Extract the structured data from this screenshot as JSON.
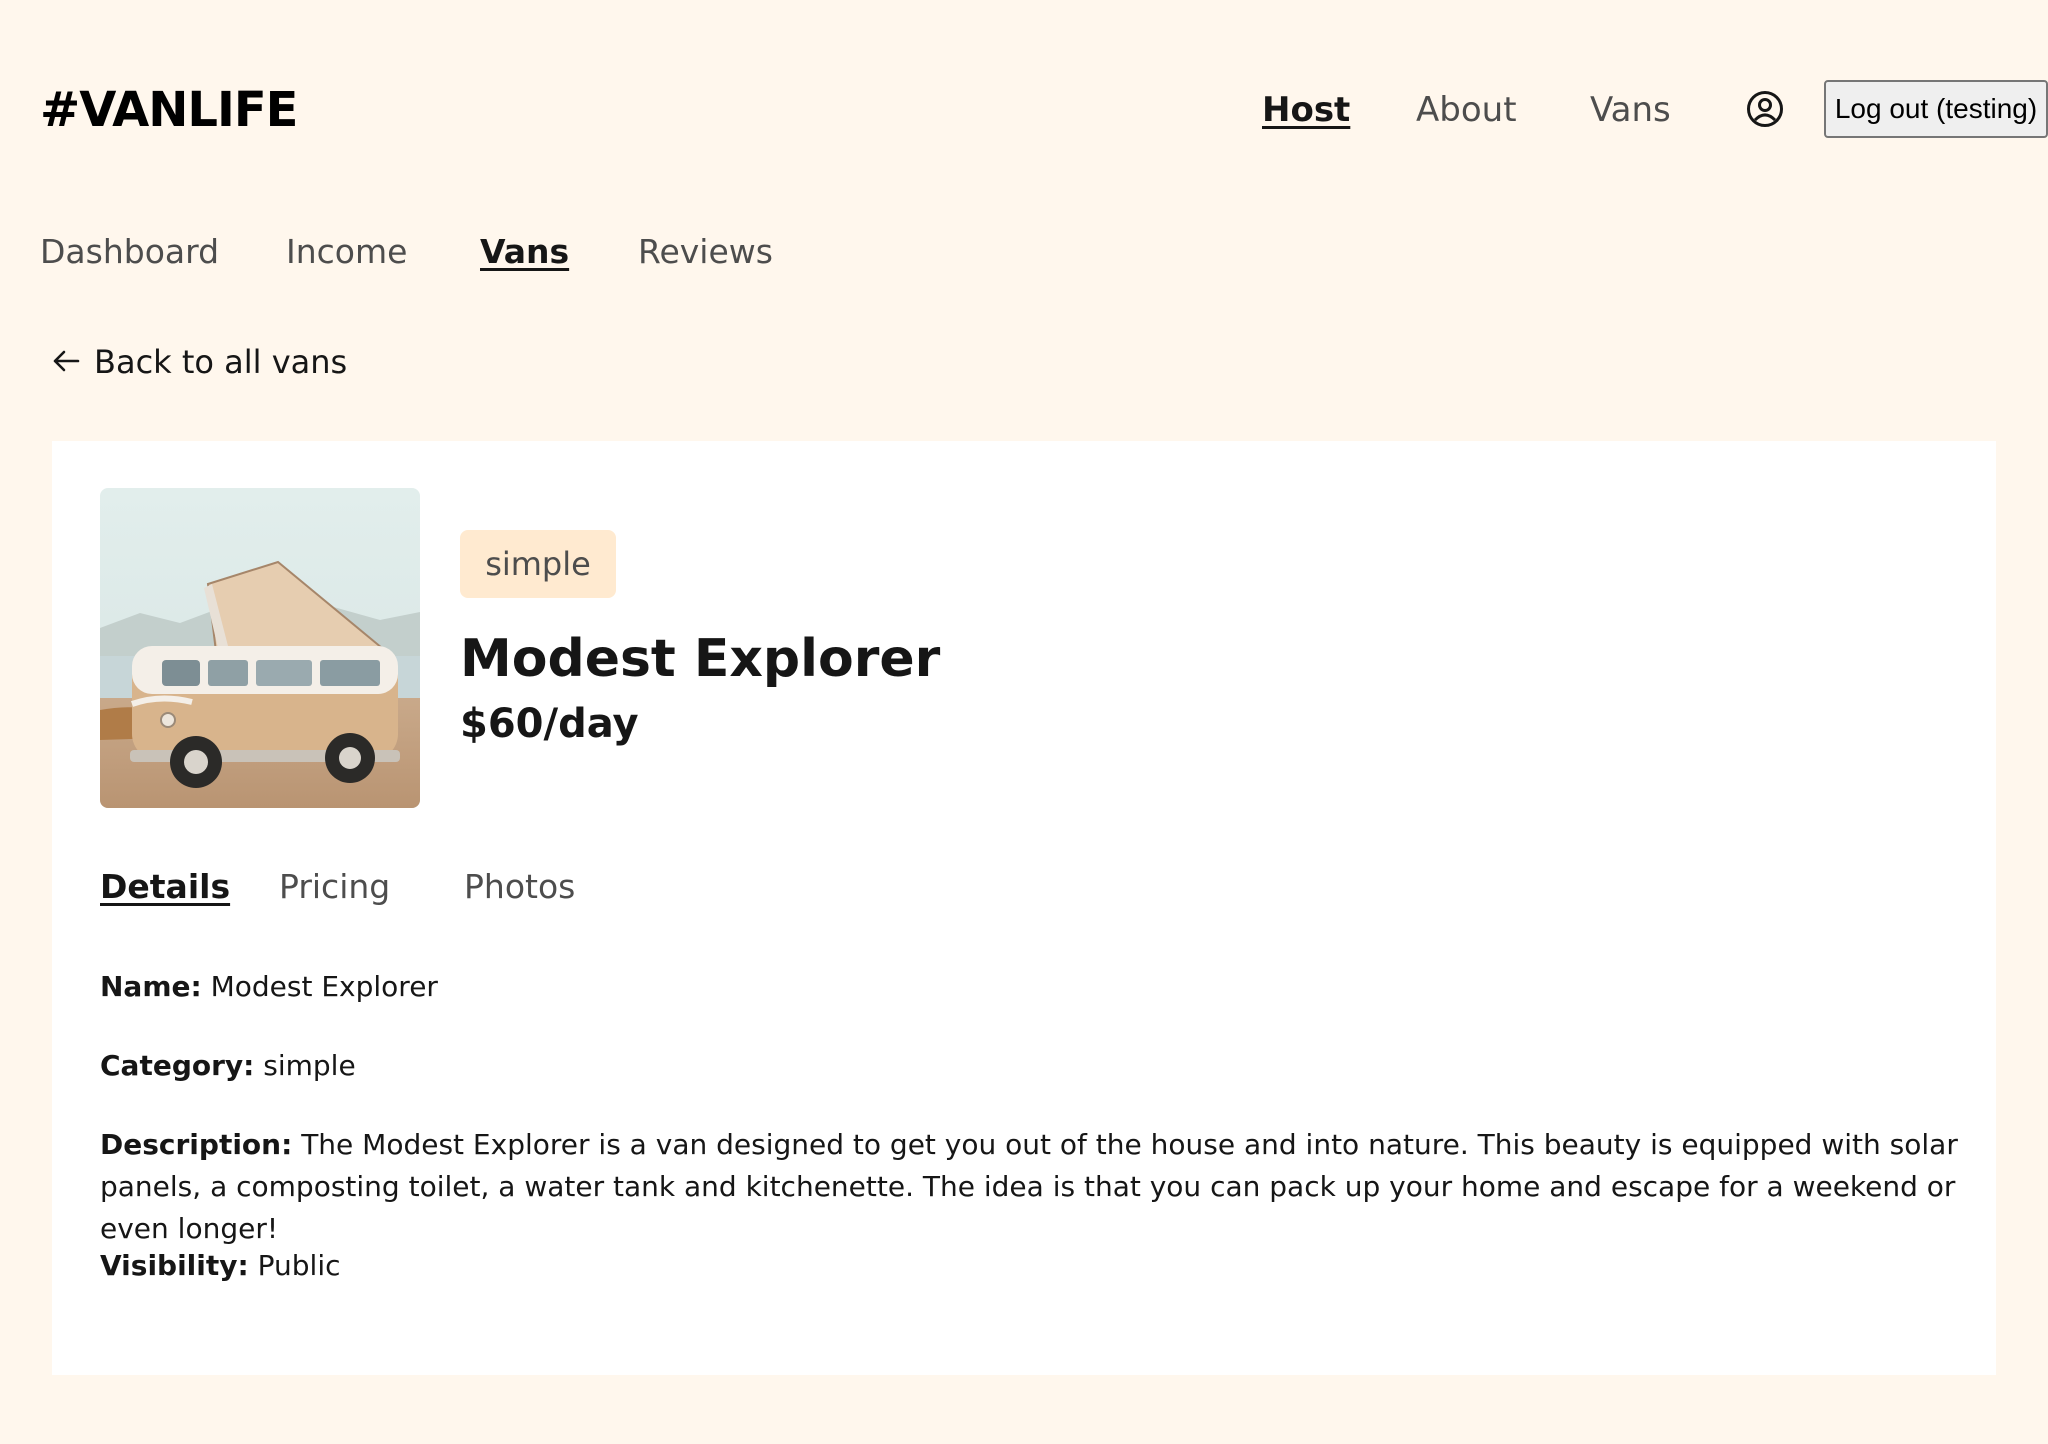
{
  "header": {
    "logo": "#VANLIFE",
    "nav": [
      {
        "label": "Host",
        "active": true
      },
      {
        "label": "About",
        "active": false
      },
      {
        "label": "Vans",
        "active": false
      }
    ],
    "avatar_icon": "user-circle-icon",
    "logout_label": "Log out (testing)"
  },
  "host_nav": [
    {
      "label": "Dashboard",
      "active": false
    },
    {
      "label": "Income",
      "active": false
    },
    {
      "label": "Vans",
      "active": true
    },
    {
      "label": "Reviews",
      "active": false
    }
  ],
  "back_link": {
    "icon": "arrow-left-icon",
    "label": "Back to all vans"
  },
  "van": {
    "type_badge": "simple",
    "name": "Modest Explorer",
    "price": "$60/day",
    "tabs": [
      {
        "label": "Details",
        "active": true
      },
      {
        "label": "Pricing",
        "active": false
      },
      {
        "label": "Photos",
        "active": false
      }
    ],
    "details": {
      "name_label": "Name:",
      "name_value": "Modest Explorer",
      "category_label": "Category:",
      "category_value": "simple",
      "description_label": "Description:",
      "description_value": "The Modest Explorer is a van designed to get you out of the house and into nature. This beauty is equipped with solar panels, a composting toilet, a water tank and kitchenette. The idea is that you can pack up your home and escape for a weekend or even longer!",
      "visibility_label": "Visibility:",
      "visibility_value": "Public"
    }
  },
  "colors": {
    "page_bg": "#FFF7ED",
    "card_bg": "#FFFFFF",
    "badge_bg": "#FFEAD0",
    "text": "#161616",
    "muted": "#4D4D4D"
  }
}
